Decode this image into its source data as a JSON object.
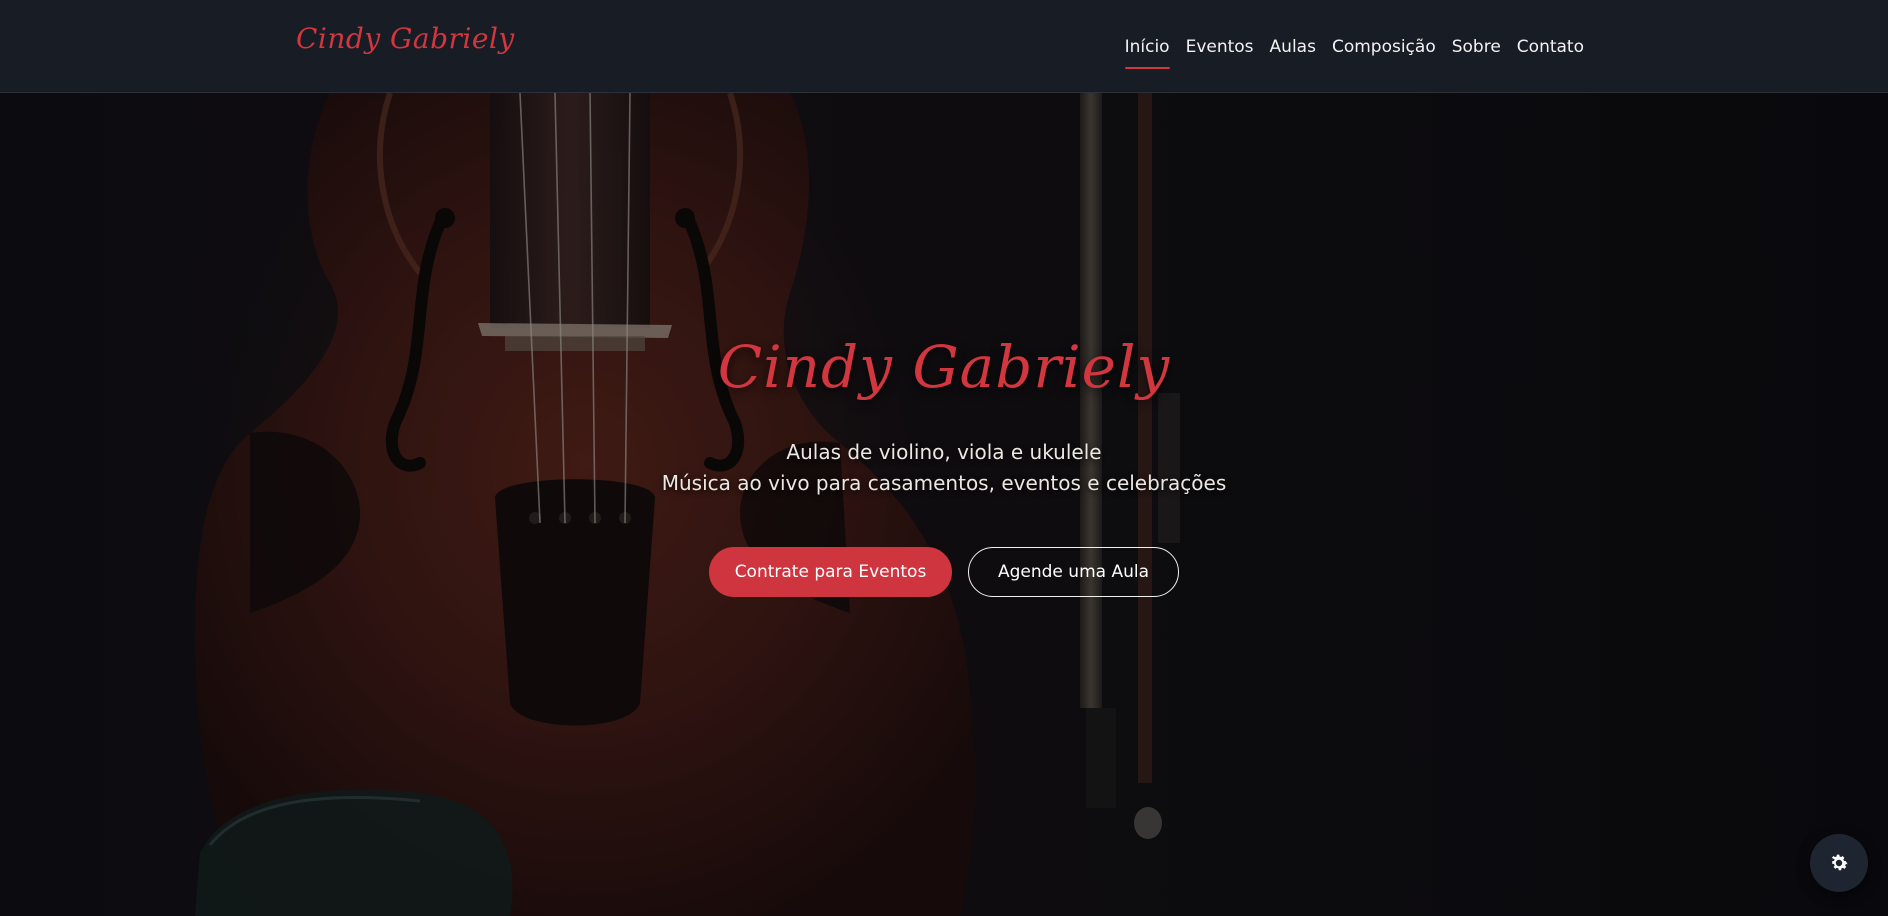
{
  "header": {
    "brand": "Cindy Gabriely",
    "nav": [
      {
        "label": "Início",
        "active": true
      },
      {
        "label": "Eventos",
        "active": false
      },
      {
        "label": "Aulas",
        "active": false
      },
      {
        "label": "Composição",
        "active": false
      },
      {
        "label": "Sobre",
        "active": false
      },
      {
        "label": "Contato",
        "active": false
      }
    ]
  },
  "hero": {
    "title": "Cindy Gabriely",
    "subtitle_line1": "Aulas de violino, viola e ukulele",
    "subtitle_line2": "Música ao vivo para casamentos, eventos e celebrações",
    "primary_cta": "Contrate para Eventos",
    "secondary_cta": "Agende uma Aula",
    "background_image": "violin-and-bow"
  },
  "settings_button": {
    "icon": "gear-icon"
  },
  "colors": {
    "accent": "#d2363e",
    "navbar_bg": "#181c25",
    "button_primary": "#cf353f",
    "fab_bg": "#1e2531"
  }
}
